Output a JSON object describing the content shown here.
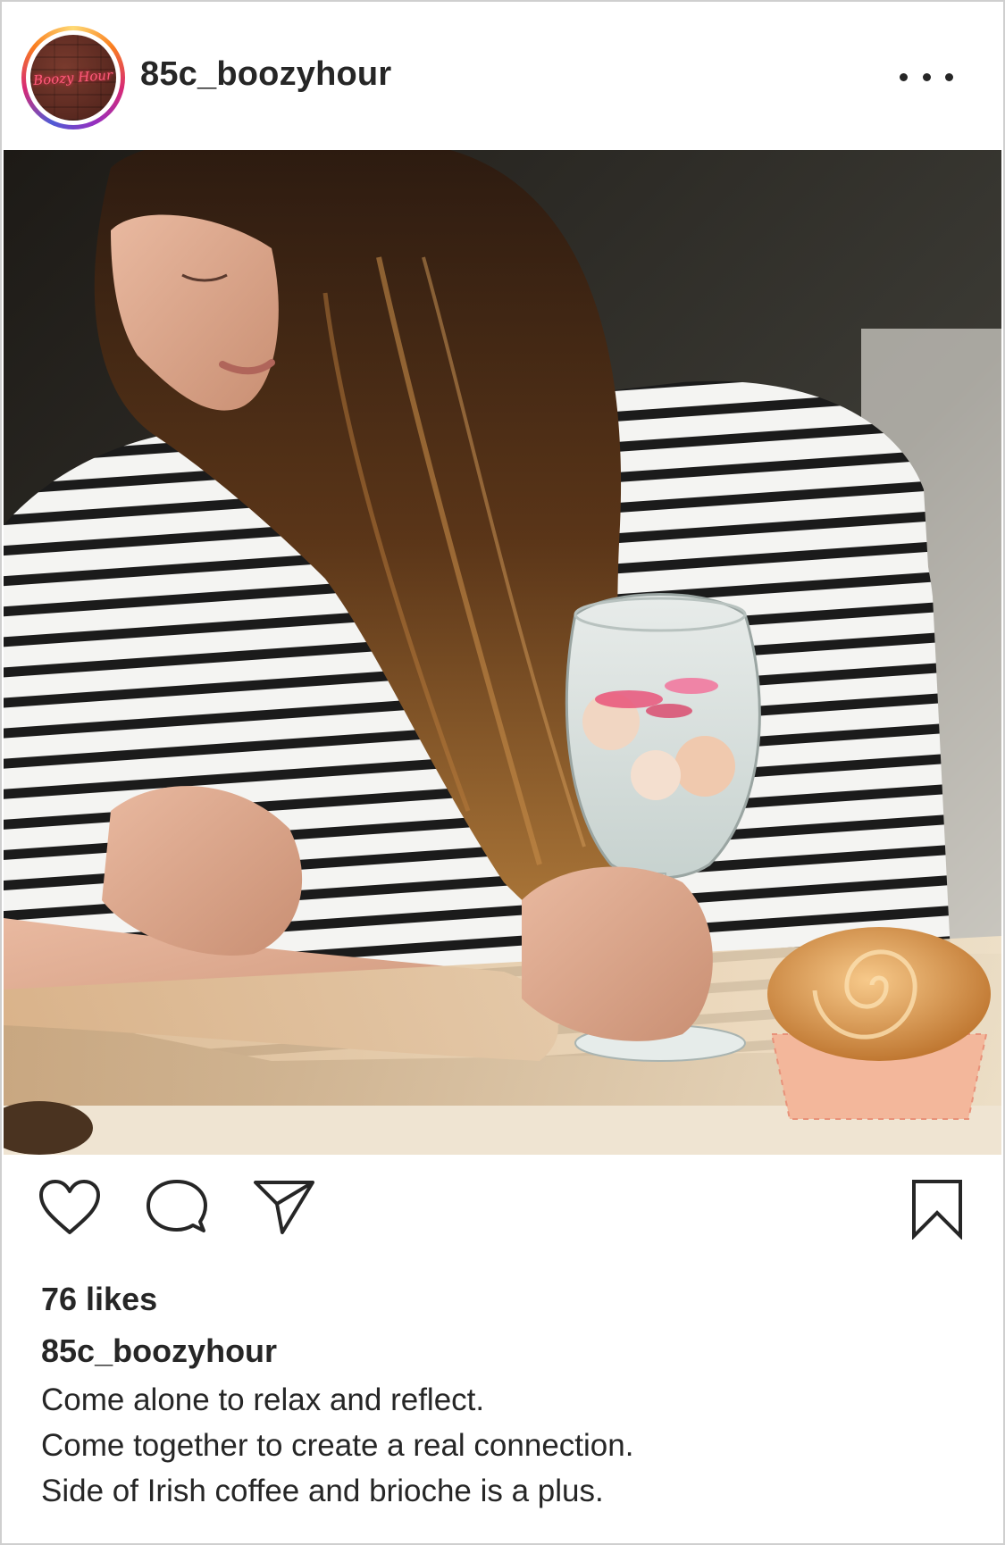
{
  "post": {
    "username": "85c_boozyhour",
    "avatar_text": "Boozy Hour",
    "likes": "76 likes",
    "caption_username": "85c_boozyhour",
    "caption_lines": [
      "Come alone to relax and reflect.",
      "Come together to create a real connection.",
      "Side of Irish coffee and brioche is a plus."
    ]
  },
  "icons": {
    "more": "more-options-icon",
    "like": "heart-icon",
    "comment": "comment-bubble-icon",
    "share": "paper-plane-icon",
    "save": "bookmark-icon"
  },
  "colors": {
    "text": "#262626",
    "ring": [
      "#feda75",
      "#fa7e1e",
      "#d62976",
      "#962fbf"
    ]
  }
}
